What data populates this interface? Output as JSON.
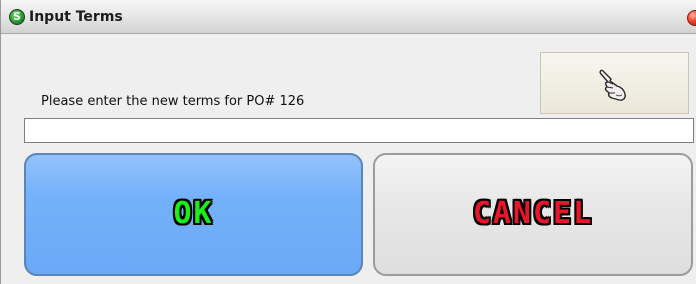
{
  "window": {
    "title": "Input Terms",
    "app_icon_letter": "S"
  },
  "dialog": {
    "prompt": "Please enter the new terms for PO# 126",
    "terms_input": {
      "value": "",
      "placeholder": ""
    },
    "hand_button_icon": "pointing-hand-icon",
    "ok_label": "OK",
    "cancel_label": "CANCEL"
  },
  "colors": {
    "ok_button": "#74b1fa",
    "ok_text": "#19ef19",
    "cancel_button": "#e8e8e8",
    "cancel_text": "#e8162a",
    "close_button": "#e8452a",
    "app_icon": "#1f9a2a"
  }
}
